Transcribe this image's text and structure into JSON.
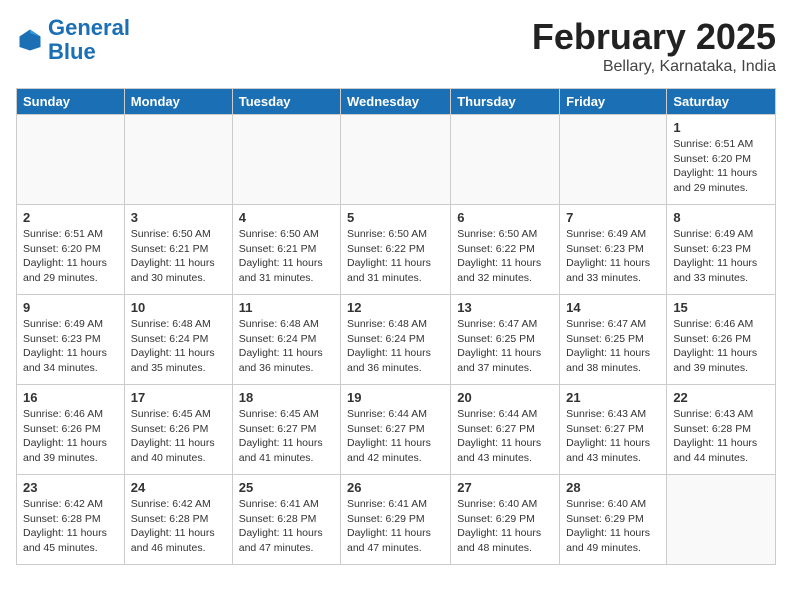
{
  "header": {
    "logo_general": "General",
    "logo_blue": "Blue",
    "month_title": "February 2025",
    "location": "Bellary, Karnataka, India"
  },
  "weekdays": [
    "Sunday",
    "Monday",
    "Tuesday",
    "Wednesday",
    "Thursday",
    "Friday",
    "Saturday"
  ],
  "weeks": [
    [
      {
        "day": "",
        "info": ""
      },
      {
        "day": "",
        "info": ""
      },
      {
        "day": "",
        "info": ""
      },
      {
        "day": "",
        "info": ""
      },
      {
        "day": "",
        "info": ""
      },
      {
        "day": "",
        "info": ""
      },
      {
        "day": "1",
        "info": "Sunrise: 6:51 AM\nSunset: 6:20 PM\nDaylight: 11 hours\nand 29 minutes."
      }
    ],
    [
      {
        "day": "2",
        "info": "Sunrise: 6:51 AM\nSunset: 6:20 PM\nDaylight: 11 hours\nand 29 minutes."
      },
      {
        "day": "3",
        "info": "Sunrise: 6:50 AM\nSunset: 6:21 PM\nDaylight: 11 hours\nand 30 minutes."
      },
      {
        "day": "4",
        "info": "Sunrise: 6:50 AM\nSunset: 6:21 PM\nDaylight: 11 hours\nand 31 minutes."
      },
      {
        "day": "5",
        "info": "Sunrise: 6:50 AM\nSunset: 6:22 PM\nDaylight: 11 hours\nand 31 minutes."
      },
      {
        "day": "6",
        "info": "Sunrise: 6:50 AM\nSunset: 6:22 PM\nDaylight: 11 hours\nand 32 minutes."
      },
      {
        "day": "7",
        "info": "Sunrise: 6:49 AM\nSunset: 6:23 PM\nDaylight: 11 hours\nand 33 minutes."
      },
      {
        "day": "8",
        "info": "Sunrise: 6:49 AM\nSunset: 6:23 PM\nDaylight: 11 hours\nand 33 minutes."
      }
    ],
    [
      {
        "day": "9",
        "info": "Sunrise: 6:49 AM\nSunset: 6:23 PM\nDaylight: 11 hours\nand 34 minutes."
      },
      {
        "day": "10",
        "info": "Sunrise: 6:48 AM\nSunset: 6:24 PM\nDaylight: 11 hours\nand 35 minutes."
      },
      {
        "day": "11",
        "info": "Sunrise: 6:48 AM\nSunset: 6:24 PM\nDaylight: 11 hours\nand 36 minutes."
      },
      {
        "day": "12",
        "info": "Sunrise: 6:48 AM\nSunset: 6:24 PM\nDaylight: 11 hours\nand 36 minutes."
      },
      {
        "day": "13",
        "info": "Sunrise: 6:47 AM\nSunset: 6:25 PM\nDaylight: 11 hours\nand 37 minutes."
      },
      {
        "day": "14",
        "info": "Sunrise: 6:47 AM\nSunset: 6:25 PM\nDaylight: 11 hours\nand 38 minutes."
      },
      {
        "day": "15",
        "info": "Sunrise: 6:46 AM\nSunset: 6:26 PM\nDaylight: 11 hours\nand 39 minutes."
      }
    ],
    [
      {
        "day": "16",
        "info": "Sunrise: 6:46 AM\nSunset: 6:26 PM\nDaylight: 11 hours\nand 39 minutes."
      },
      {
        "day": "17",
        "info": "Sunrise: 6:45 AM\nSunset: 6:26 PM\nDaylight: 11 hours\nand 40 minutes."
      },
      {
        "day": "18",
        "info": "Sunrise: 6:45 AM\nSunset: 6:27 PM\nDaylight: 11 hours\nand 41 minutes."
      },
      {
        "day": "19",
        "info": "Sunrise: 6:44 AM\nSunset: 6:27 PM\nDaylight: 11 hours\nand 42 minutes."
      },
      {
        "day": "20",
        "info": "Sunrise: 6:44 AM\nSunset: 6:27 PM\nDaylight: 11 hours\nand 43 minutes."
      },
      {
        "day": "21",
        "info": "Sunrise: 6:43 AM\nSunset: 6:27 PM\nDaylight: 11 hours\nand 43 minutes."
      },
      {
        "day": "22",
        "info": "Sunrise: 6:43 AM\nSunset: 6:28 PM\nDaylight: 11 hours\nand 44 minutes."
      }
    ],
    [
      {
        "day": "23",
        "info": "Sunrise: 6:42 AM\nSunset: 6:28 PM\nDaylight: 11 hours\nand 45 minutes."
      },
      {
        "day": "24",
        "info": "Sunrise: 6:42 AM\nSunset: 6:28 PM\nDaylight: 11 hours\nand 46 minutes."
      },
      {
        "day": "25",
        "info": "Sunrise: 6:41 AM\nSunset: 6:28 PM\nDaylight: 11 hours\nand 47 minutes."
      },
      {
        "day": "26",
        "info": "Sunrise: 6:41 AM\nSunset: 6:29 PM\nDaylight: 11 hours\nand 47 minutes."
      },
      {
        "day": "27",
        "info": "Sunrise: 6:40 AM\nSunset: 6:29 PM\nDaylight: 11 hours\nand 48 minutes."
      },
      {
        "day": "28",
        "info": "Sunrise: 6:40 AM\nSunset: 6:29 PM\nDaylight: 11 hours\nand 49 minutes."
      },
      {
        "day": "",
        "info": ""
      }
    ]
  ]
}
